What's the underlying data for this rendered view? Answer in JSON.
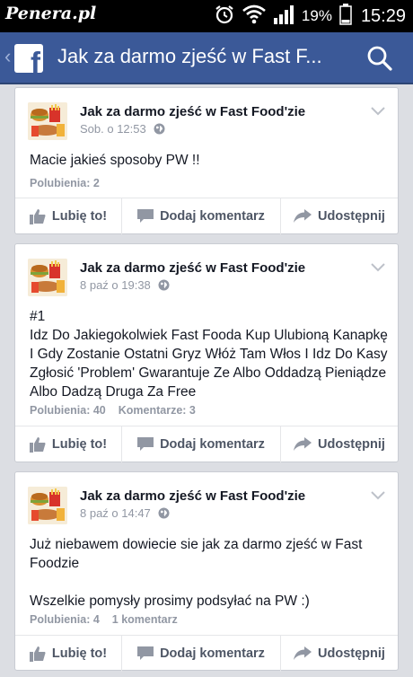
{
  "status_bar": {
    "watermark": "Penera.pl",
    "battery_percent": "19%",
    "time": "15:29"
  },
  "app_bar": {
    "title": "Jak za darmo zjeść w Fast F...",
    "logo_letter": "f",
    "back_icon": "chevron-left-icon",
    "search_icon": "search-icon"
  },
  "colors": {
    "facebook_blue": "#3b5998",
    "meta_gray": "#9197a3",
    "action_gray": "#4e5665"
  },
  "posts": [
    {
      "author": "Jak za darmo zjeść w Fast Food'zie",
      "time": "Sob. o 12:53",
      "body": "Macie jakieś sposoby PW !!",
      "likes": "Polubienia: 2",
      "comments": "",
      "actions": {
        "like": "Lubię to!",
        "comment": "Dodaj komentarz",
        "share": "Udostępnij"
      }
    },
    {
      "author": "Jak za darmo zjeść w Fast Food'zie",
      "time": "8 paź o 19:38",
      "body": "#1\nIdz Do Jakiegokolwiek Fast Fooda Kup Ulubioną Kanapkę I Gdy Zostanie Ostatni Gryz Włóż Tam Włos I Idz Do Kasy Zgłosić 'Problem' Gwarantuje Ze Albo Oddadzą Pieniądze Albo Dadzą Druga Za Free",
      "likes": "Polubienia: 40",
      "comments": "Komentarze: 3",
      "actions": {
        "like": "Lubię to!",
        "comment": "Dodaj komentarz",
        "share": "Udostępnij"
      }
    },
    {
      "author": "Jak za darmo zjeść w Fast Food'zie",
      "time": "8 paź o 14:47",
      "body": "Już niebawem dowiecie sie jak za darmo zjeść w Fast Foodzie\n\nWszelkie pomysły prosimy podsyłać na PW :)",
      "likes": "Polubienia: 4",
      "comments": "1 komentarz",
      "actions": {
        "like": "Lubię to!",
        "comment": "Dodaj komentarz",
        "share": "Udostępnij"
      }
    }
  ]
}
